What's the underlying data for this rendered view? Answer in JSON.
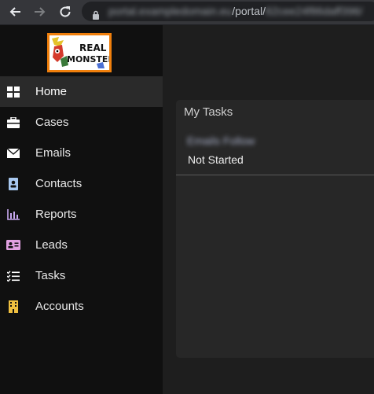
{
  "browser": {
    "url_blurred_host": "portal.exampledomain.eu",
    "url_path": "/portal/",
    "url_blurred_id": "62cee24f86daff396/"
  },
  "sidebar": {
    "logo_text": "REAL MONSTERS",
    "items": [
      {
        "label": "Home",
        "icon": "home-icon",
        "active": true
      },
      {
        "label": "Cases",
        "icon": "briefcase-icon",
        "active": false
      },
      {
        "label": "Emails",
        "icon": "envelope-icon",
        "active": false
      },
      {
        "label": "Contacts",
        "icon": "contact-card-icon",
        "active": false
      },
      {
        "label": "Reports",
        "icon": "bar-chart-icon",
        "active": false
      },
      {
        "label": "Leads",
        "icon": "id-card-icon",
        "active": false
      },
      {
        "label": "Tasks",
        "icon": "task-list-icon",
        "active": false
      },
      {
        "label": "Accounts",
        "icon": "building-icon",
        "active": false
      }
    ]
  },
  "tasks_panel": {
    "title": "My Tasks",
    "task_name_blurred": "Emails Follow",
    "task_status": "Not Started"
  },
  "colors": {
    "logo_border": "#f07f0c",
    "sidebar_bg": "#101010",
    "reports_icon": "#c8a8f0",
    "leads_icon": "#e0a0e0",
    "accounts_icon": "#f0c040",
    "contacts_icon": "#a8c8f0"
  }
}
